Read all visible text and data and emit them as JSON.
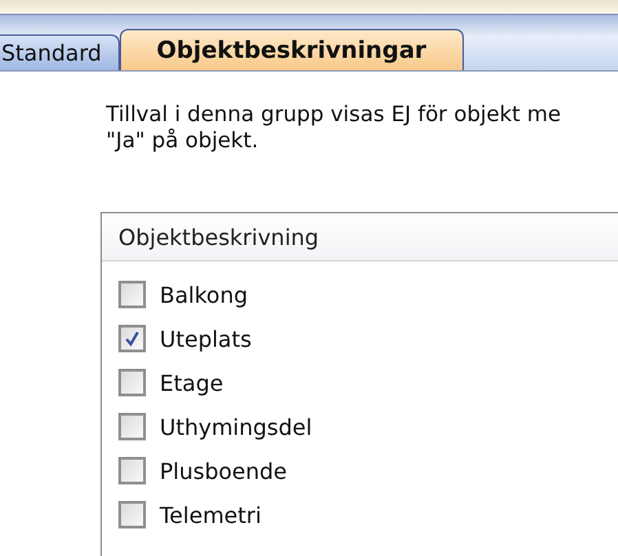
{
  "tabs": [
    {
      "label": "Standard",
      "selected": false
    },
    {
      "label": "Objektbeskrivningar",
      "selected": true
    }
  ],
  "description": "Tillval i denna grupp visas EJ för objekt me\n\"Ja\" på objekt.",
  "list": {
    "header": "Objektbeskrivning",
    "items": [
      {
        "label": "Balkong",
        "checked": false
      },
      {
        "label": "Uteplats",
        "checked": true
      },
      {
        "label": "Etage",
        "checked": false
      },
      {
        "label": "Uthymingsdel",
        "checked": false
      },
      {
        "label": "Plusboende",
        "checked": false
      },
      {
        "label": "Telemetri",
        "checked": false
      }
    ]
  }
}
